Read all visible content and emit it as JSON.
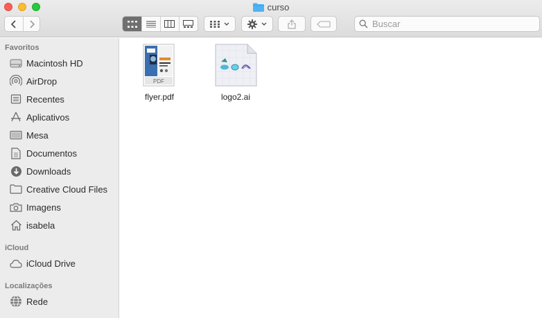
{
  "window": {
    "title": "curso"
  },
  "toolbar": {
    "back_label": "back",
    "forward_label": "forward",
    "search_placeholder": "Buscar"
  },
  "sidebar": {
    "sections": {
      "favorites": "Favoritos",
      "icloud": "iCloud",
      "locations": "Localizações"
    },
    "favorites": [
      {
        "label": "Macintosh HD",
        "icon": "hard-drive-icon"
      },
      {
        "label": "AirDrop",
        "icon": "airdrop-icon"
      },
      {
        "label": "Recentes",
        "icon": "recents-icon"
      },
      {
        "label": "Aplicativos",
        "icon": "applications-icon"
      },
      {
        "label": "Mesa",
        "icon": "desktop-icon"
      },
      {
        "label": "Documentos",
        "icon": "document-icon"
      },
      {
        "label": "Downloads",
        "icon": "download-icon"
      },
      {
        "label": "Creative Cloud Files",
        "icon": "folder-icon"
      },
      {
        "label": "Imagens",
        "icon": "camera-icon"
      },
      {
        "label": "isabela",
        "icon": "home-icon"
      }
    ],
    "icloud": [
      {
        "label": "iCloud Drive",
        "icon": "cloud-icon"
      }
    ],
    "locations": [
      {
        "label": "Rede",
        "icon": "network-icon"
      }
    ]
  },
  "files": [
    {
      "name": "flyer.pdf",
      "icon": "pdf-file-icon",
      "badge": "PDF"
    },
    {
      "name": "logo2.ai",
      "icon": "ai-file-icon"
    }
  ],
  "colors": {
    "folder_blue": "#4fb2f4",
    "sidebar_bg": "#ececec",
    "active_view": "#6f6f6f"
  }
}
